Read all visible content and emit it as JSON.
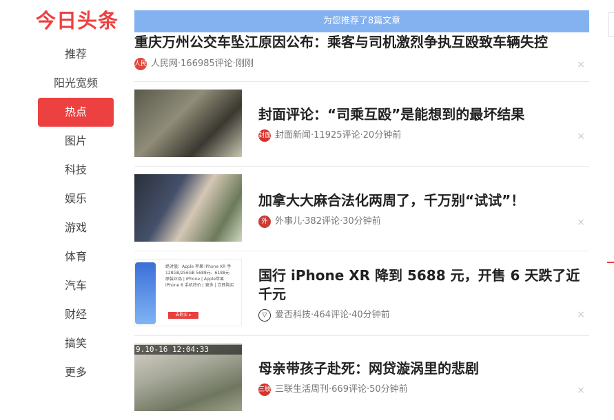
{
  "logo": "今日头条",
  "nav": [
    {
      "label": "推荐",
      "active": false
    },
    {
      "label": "阳光宽频",
      "active": false
    },
    {
      "label": "热点",
      "active": true
    },
    {
      "label": "图片",
      "active": false
    },
    {
      "label": "科技",
      "active": false
    },
    {
      "label": "娱乐",
      "active": false
    },
    {
      "label": "游戏",
      "active": false
    },
    {
      "label": "体育",
      "active": false
    },
    {
      "label": "汽车",
      "active": false
    },
    {
      "label": "财经",
      "active": false
    },
    {
      "label": "搞笑",
      "active": false
    },
    {
      "label": "更多",
      "active": false
    }
  ],
  "banner": "为您推荐了8篇文章",
  "articles": [
    {
      "title": "重庆万州公交车坠江原因公布：乘客与司机激烈争执互殴致车辆失控",
      "source": "人民网",
      "comments": "166985评论",
      "time": "刚刚",
      "source_icon": "人民",
      "source_color": "#e0453a"
    },
    {
      "title": "封面评论：“司乘互殴”是能想到的最坏结果",
      "source": "封面新闻",
      "comments": "11925评论",
      "time": "20分钟前",
      "source_icon": "封面",
      "source_color": "#d8322c"
    },
    {
      "title": "加拿大大麻合法化两周了，千万别“试试”！",
      "source": "外事儿",
      "comments": "382评论",
      "time": "30分钟前",
      "source_icon": "外",
      "source_color": "#cc3c34"
    },
    {
      "title": "国行 iPhone XR 降到 5688 元，开售 6 天跌了近千元",
      "source": "爱否科技",
      "comments": "464评论",
      "time": "40分钟前",
      "source_icon": "▽",
      "source_color": "#333333"
    },
    {
      "title": "母亲带孩子赴死：网贷漩涡里的悲剧",
      "source": "三联生活周刊",
      "comments": "669评论",
      "time": "50分钟前",
      "source_icon": "三联",
      "source_color": "#d6342c"
    }
  ],
  "thumb_text": {
    "phone_ad": [
      "绝对值：Apple 苹果 iPhone XR 手",
      "128GB/256GB 5688元、6188元",
      "原装正品 | iPhone | Apple苹果",
      "iPhone 8 手机特价 | 更多 | 立即购买"
    ],
    "phone_ad_btn": "去购买 ▸",
    "cctv_stamp": "9.10-16  12:04:33"
  },
  "close_glyph": "×",
  "separator": " · "
}
